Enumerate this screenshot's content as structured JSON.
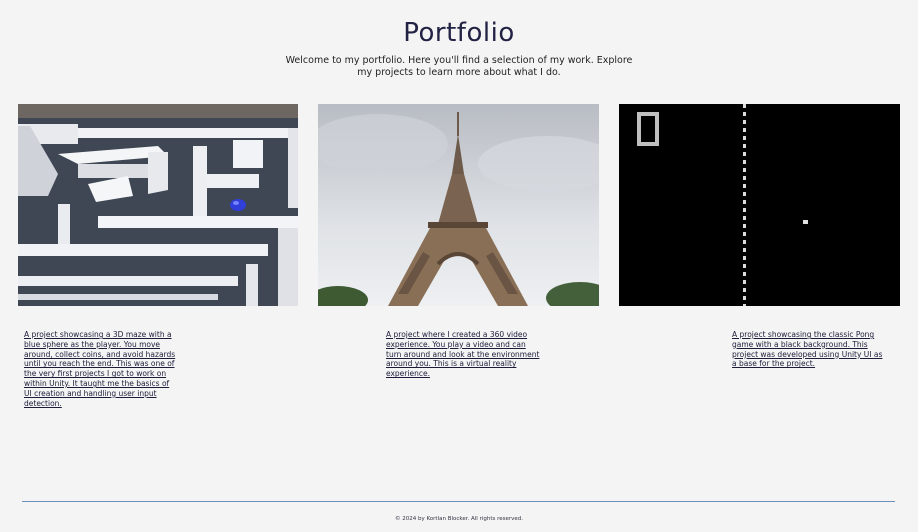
{
  "header": {
    "title": "Portfolio",
    "intro": "Welcome to my portfolio. Here you'll find a selection of my work. Explore my projects to learn more about what I do."
  },
  "projects": [
    {
      "image": "3d-maze-screenshot",
      "description": "A project showcasing a 3D maze with a blue sphere as the player. You move around, collect coins, and avoid hazards until you reach the end. This was one of the very first projects I got to work on within Unity. It taught me the basics of UI creation and handling user input detection."
    },
    {
      "image": "eiffel-tower-photo",
      "description": "A project where I created a 360 video experience. You play a video and can turn around and look at the environment around you. This is a virtual reality experience."
    },
    {
      "image": "pong-game-screenshot",
      "description": "A project showcasing the classic Pong game with a black background. This project was developed using Unity UI as a base for the project."
    }
  ],
  "footer": {
    "text": "© 2024 by Kortlan Blocker. All rights reserved."
  }
}
